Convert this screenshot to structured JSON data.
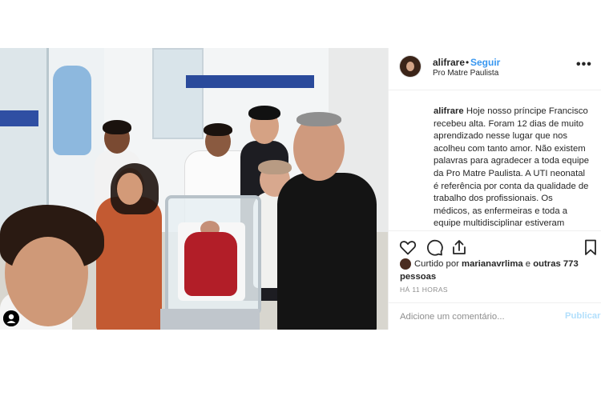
{
  "post": {
    "username": "alifrare",
    "follow_separator": "•",
    "follow_label": "Seguir",
    "location": "Pro Matre Paulista",
    "more_icon": "more-options-icon",
    "caption_user": "alifrare",
    "caption_text": "Hoje nosso príncipe Francisco recebeu alta. Foram 12 dias de muito aprendizado nesse lugar que nos acolheu com tanto amor. Não existem palavras para agradecer a toda equipe da Pro Matre Paulista. A UTI neonatal é referência por conta da qualidade de trabalho dos profissionais. Os médicos, as enfermeiras e toda a equipe multidisciplinar estiveram sempre presentes ajudando",
    "likes_prefix": "Curtido por",
    "likes_user": "marianavrlima",
    "likes_connector": "e",
    "likes_others": "outras 773 pessoas",
    "timestamp": "HÁ 11 HORAS",
    "comment_placeholder": "Adicione um comentário...",
    "publish_label": "Publicar",
    "colors": {
      "link_blue": "#3897f0",
      "publish_disabled": "#b2dffc",
      "text": "#262626",
      "muted": "#8e8e8e"
    },
    "icons": [
      "heart-icon",
      "comment-icon",
      "share-icon",
      "bookmark-icon",
      "user-tag-icon"
    ]
  }
}
